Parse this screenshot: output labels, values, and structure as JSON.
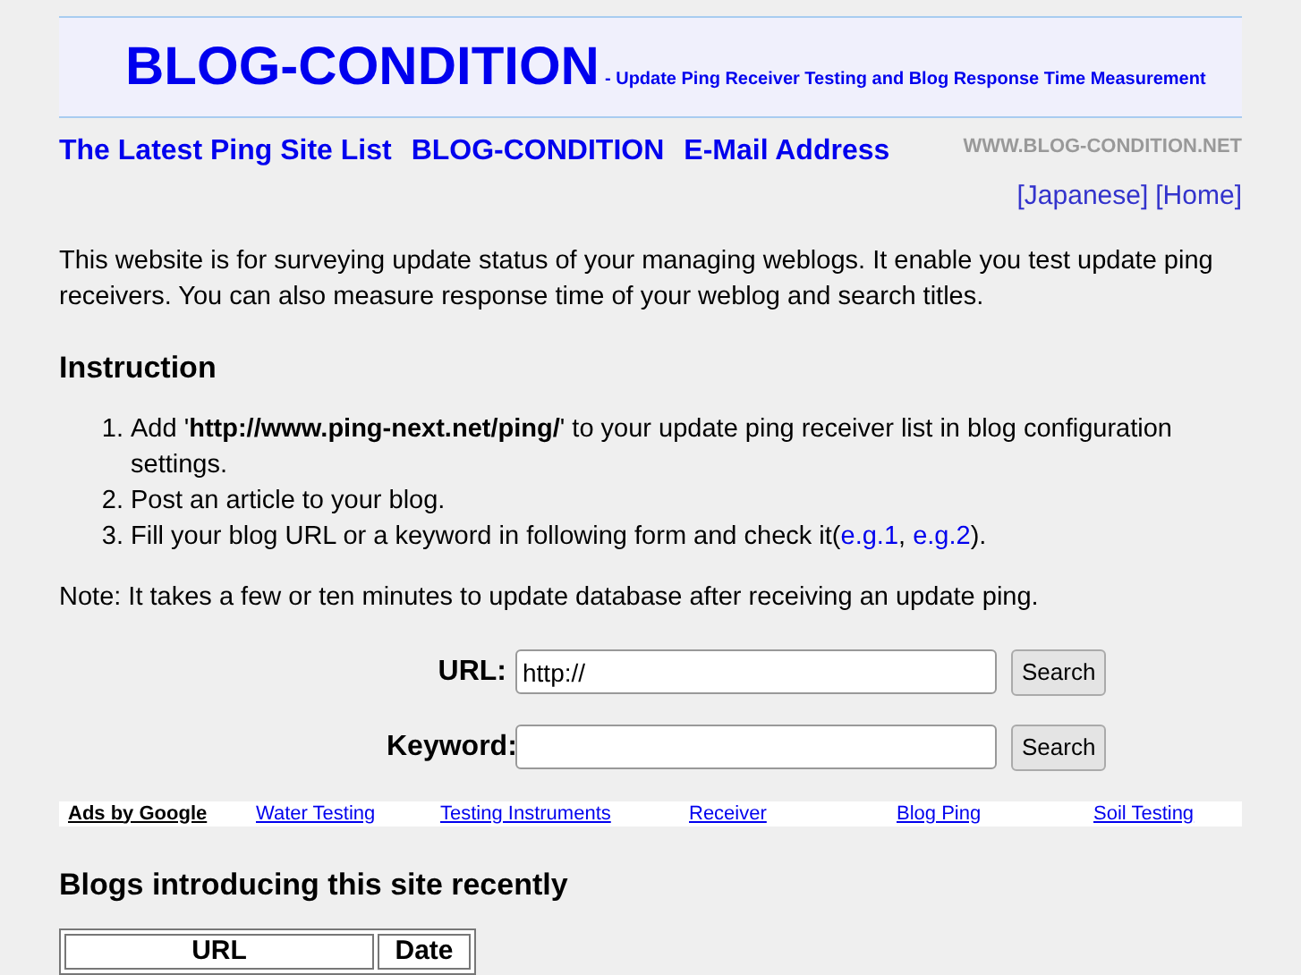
{
  "header": {
    "title": "BLOG-CONDITION",
    "subtitle": "- Update Ping Receiver Testing and Blog Response Time Measurement"
  },
  "nav": {
    "links": [
      "The Latest Ping Site List",
      "BLOG-CONDITION",
      "E-Mail Address"
    ],
    "domain": "WWW.BLOG-CONDITION.NET",
    "lang_links": [
      "[Japanese]",
      "[Home]"
    ]
  },
  "intro": "This website is for surveying update status of your managing weblogs. It enable you test update ping receivers. You can also measure response time of your weblog and search titles.",
  "instruction": {
    "heading": "Instruction",
    "steps": [
      {
        "marker": "1.",
        "text": "Add '**http://www.ping-next.net/ping/**' to your update ping receiver list in blog configuration settings."
      },
      {
        "marker": "2.",
        "text": "Post an article to your blog."
      },
      {
        "marker": "3.",
        "text": "Fill your blog URL or a keyword in following form and check it(",
        "links": [
          "e.g.1",
          "e.g.2"
        ],
        "separator": ", ",
        "after": ")."
      }
    ]
  },
  "note": "Note: It takes a few or ten minutes to update database after receiving an update ping.",
  "form": [
    {
      "label": "URL:",
      "value": "http://",
      "button": "Search"
    },
    {
      "label": "Keyword:",
      "button": "Search"
    }
  ],
  "ads": {
    "label": "Ads by Google",
    "links": [
      "Water Testing",
      "Testing Instruments",
      "Receiver",
      "Blog Ping",
      "Soil Testing"
    ]
  },
  "blogs": {
    "heading": "Blogs introducing this site recently",
    "columns": [
      "URL",
      "Date"
    ]
  }
}
